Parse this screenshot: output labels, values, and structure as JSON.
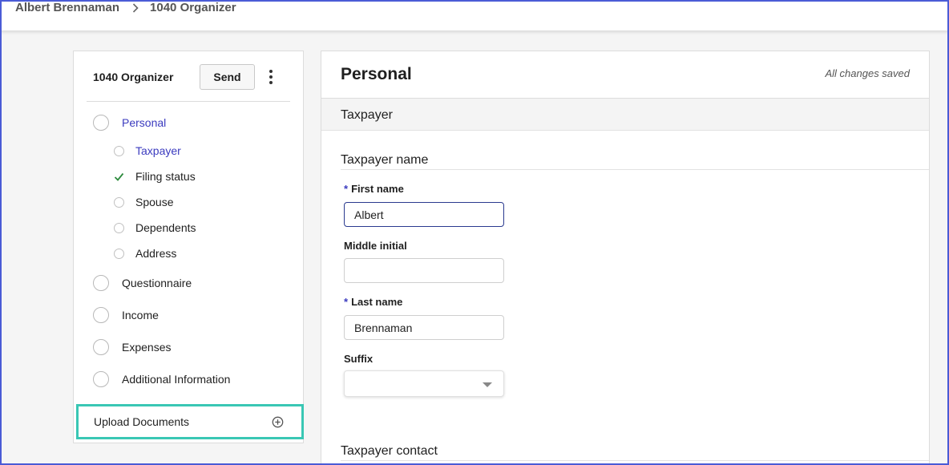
{
  "breadcrumb": {
    "client": "Albert Brennaman",
    "current": "1040 Organizer"
  },
  "sidebar": {
    "title": "1040 Organizer",
    "send_label": "Send",
    "sections": [
      {
        "label": "Personal",
        "active": true,
        "children": [
          {
            "label": "Taxpayer",
            "state": "active"
          },
          {
            "label": "Filing status",
            "state": "complete"
          },
          {
            "label": "Spouse",
            "state": "empty"
          },
          {
            "label": "Dependents",
            "state": "empty"
          },
          {
            "label": "Address",
            "state": "empty"
          }
        ]
      },
      {
        "label": "Questionnaire"
      },
      {
        "label": "Income"
      },
      {
        "label": "Expenses"
      },
      {
        "label": "Additional Information"
      }
    ],
    "upload_label": "Upload Documents"
  },
  "main": {
    "title": "Personal",
    "save_status": "All changes saved",
    "section_label": "Taxpayer",
    "name_group_title": "Taxpayer name",
    "fields": {
      "first_name": {
        "label": "First name",
        "value": "Albert"
      },
      "middle_initial": {
        "label": "Middle initial",
        "value": ""
      },
      "last_name": {
        "label": "Last name",
        "value": "Brennaman"
      },
      "suffix": {
        "label": "Suffix",
        "value": ""
      }
    },
    "required_marker": "*",
    "contact_group_title": "Taxpayer contact"
  },
  "colors": {
    "accent": "#3b3bbf",
    "highlight": "#39c7b4",
    "check": "#2e8b3e",
    "frame": "#4a5bd6"
  }
}
